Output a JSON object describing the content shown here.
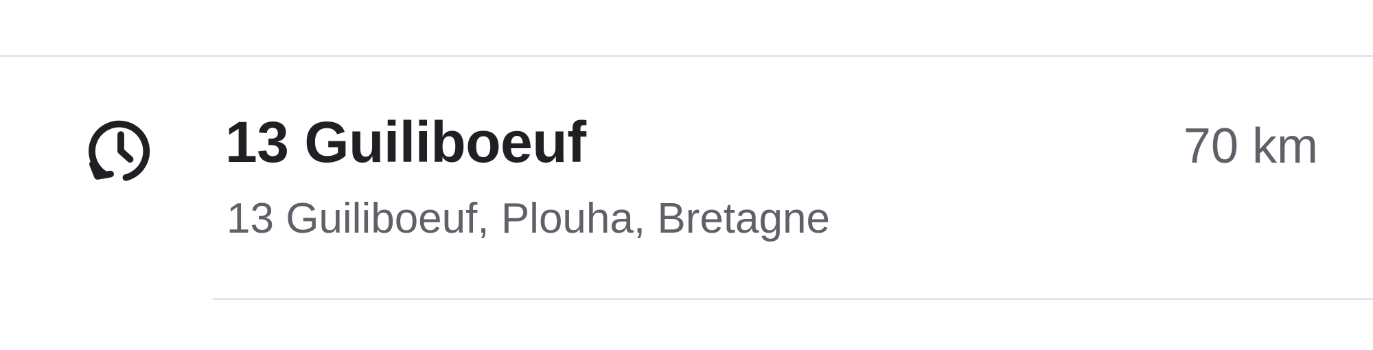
{
  "result": {
    "icon": "history-icon",
    "title": "13 Guiliboeuf",
    "address": "13 Guiliboeuf, Plouha, Bretagne",
    "distance": "70 km"
  },
  "colors": {
    "title": "#1f2024",
    "secondary": "#5f6168",
    "divider": "#e6e6e8"
  }
}
